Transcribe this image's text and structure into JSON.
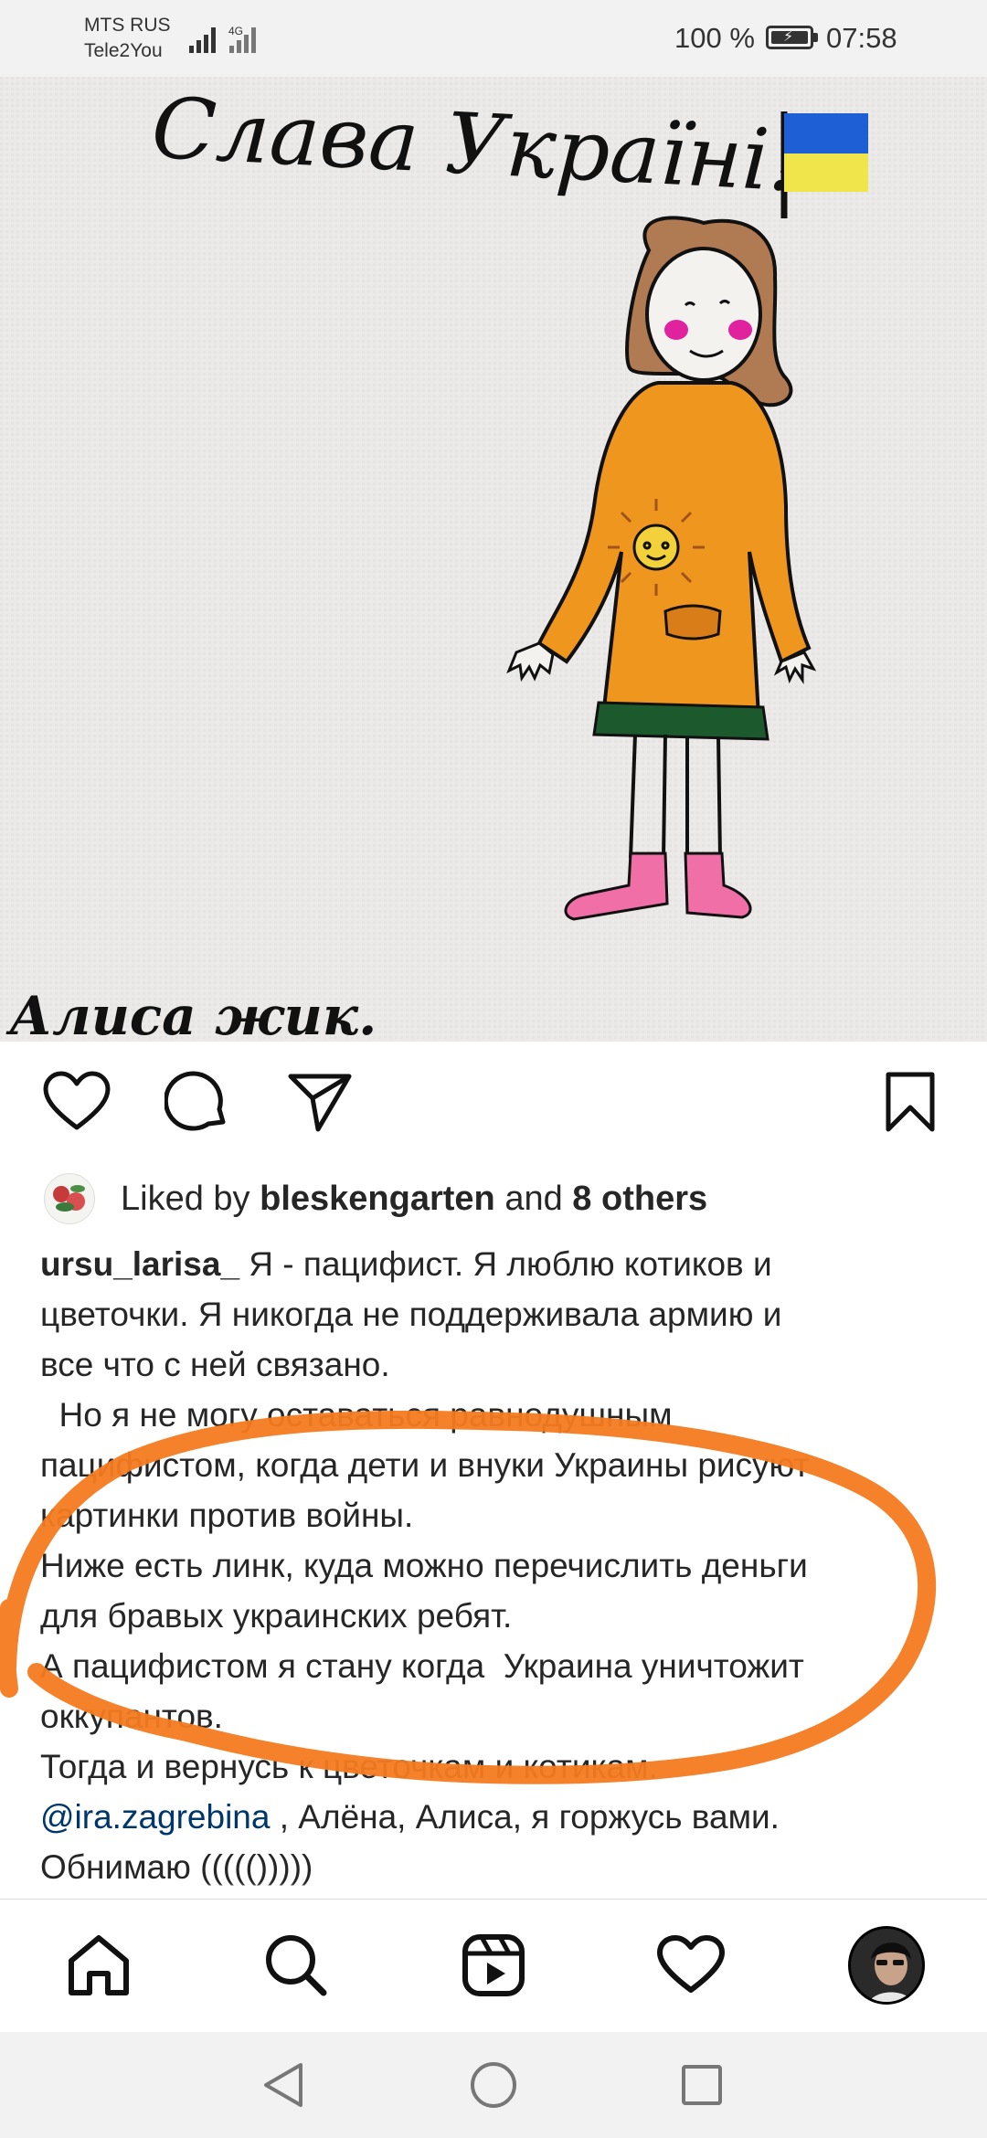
{
  "status_bar": {
    "carrier_1": "MTS RUS",
    "carrier_2": "Tele2You",
    "network": "4G",
    "battery": "100 %",
    "time": "07:58"
  },
  "post": {
    "image": {
      "handwritten_title": "Слава Україні!",
      "handwritten_signature": "Алиса жик.",
      "flag_colors": [
        "#1e5fd6",
        "#f0e54a"
      ]
    },
    "actions": {
      "like_icon": "heart-icon",
      "comment_icon": "comment-icon",
      "share_icon": "send-icon",
      "save_icon": "bookmark-icon"
    },
    "likes": {
      "prefix": "Liked by",
      "user": "bleskengarten",
      "joiner": "and",
      "others": "8 others"
    },
    "caption": {
      "username": "ursu_larisa_",
      "line1": " Я - пацифист. Я люблю котиков и",
      "line2": "цветочки. Я никогда не поддерживала армию и",
      "line3": "все что с ней связано.",
      "line4": "  Но я не могу оставаться равнодушным",
      "line5": "пацифистом, когда дети и внуки Украины рисуют",
      "line6": "картинки против войны.",
      "line7": "Ниже есть линк, куда можно перечислить деньги",
      "line8": "для бравых украинских ребят.",
      "line9": "А пацифистом я стану когда  Украина уничтожит",
      "line10": "оккупантов.",
      "line11": "Тогда и вернусь к цветочкам и котикам.",
      "mention": "@ira.zagrebina",
      "line12_rest": " , Алёна, Алиса, я горжусь вами.",
      "line13": "Обнимаю ((((()))))"
    },
    "annotation_color": "#f47a20"
  },
  "bottom_nav": {
    "items": [
      "home-icon",
      "search-icon",
      "reels-icon",
      "activity-heart-icon",
      "profile-avatar"
    ]
  },
  "system_nav": {
    "items": [
      "back-icon",
      "home-circle-icon",
      "recents-icon"
    ]
  }
}
